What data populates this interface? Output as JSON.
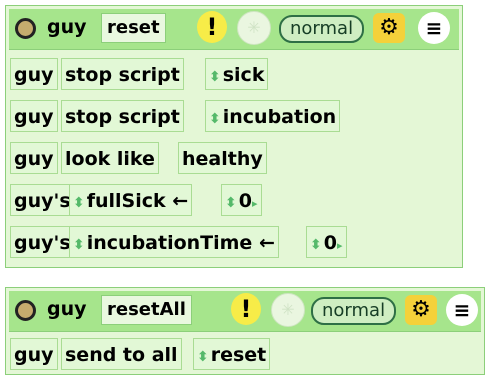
{
  "scripts": [
    {
      "object": "guy",
      "script_name": "reset",
      "status": "normal",
      "warning_icon": "!",
      "rows": [
        {
          "player": "guy",
          "command": "stop script",
          "arg": "sick"
        },
        {
          "player": "guy",
          "command": "stop script",
          "arg": "incubation"
        },
        {
          "player": "guy",
          "command": "look like",
          "arg": "healthy"
        },
        {
          "player": "guy's",
          "variable": "fullSick",
          "assign": "←",
          "value": "0"
        },
        {
          "player": "guy's",
          "variable": "incubationTime",
          "assign": "←",
          "value": "0"
        }
      ]
    },
    {
      "object": "guy",
      "script_name": "resetAll",
      "status": "normal",
      "warning_icon": "!",
      "rows": [
        {
          "player": "guy",
          "command": "send to all",
          "arg": "reset"
        }
      ]
    }
  ],
  "icons": {
    "arg_arrows": "⬍",
    "value_arrow": "▸",
    "install": "⚙",
    "menu": "≡"
  },
  "colors": {
    "header": "#a6e58c",
    "body": "#e4f7d6",
    "border": "#8ccf7a",
    "warning": "#f7ec48"
  }
}
